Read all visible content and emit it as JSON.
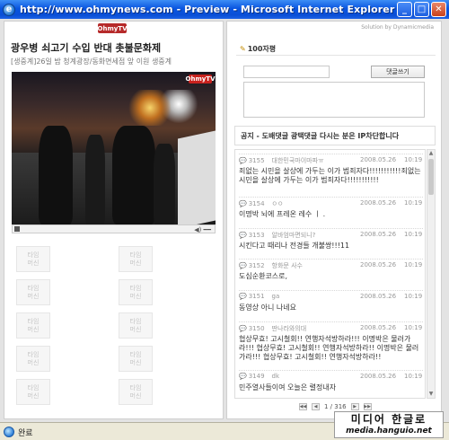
{
  "window": {
    "title": "http://www.ohmynews.com - Preview - Microsoft Internet Explorer",
    "minimize": "_",
    "maximize": "□",
    "close": "✕"
  },
  "left": {
    "tab_label": "OhmyTV",
    "headline": "광우병 쇠고기 수입 반대 촛불문화제",
    "subhead": "[생중계]26일 밤 청계광장/동화면세점 앞 이원 생중계",
    "video_badge": "OhmyTV",
    "volume": "◀) ━━",
    "tile_label_1": "타임",
    "tile_label_2": "머신",
    "tile_count": 10
  },
  "right": {
    "solution": "Solution by Dynamicmedia",
    "comment_count": "100자평",
    "post_button": "댓글쓰기",
    "notice": "공지 - 도배댓글 광택댓글 다시는 분은 IP차단합니다",
    "comments": [
      {
        "num": "3155",
        "user": "대한민국마이마파ㅠ",
        "date": "2008.05.26",
        "time": "10:19",
        "text": "죄없는 시민을 살상에 가두는 이가 범죄자다!!!!!!!!!!!죄없는 시민을 살상에 가두는 이가 범죄자다!!!!!!!!!!!"
      },
      {
        "num": "3154",
        "user": "ㅇㅇ",
        "date": "2008.05.26",
        "time": "10:19",
        "text": "이명박 뇌에 프레온 레수 ㅣ ."
      },
      {
        "num": "3153",
        "user": "알바엄마면되니?",
        "date": "2008.05.26",
        "time": "10:19",
        "text": "시킨다고 때리나 전경들 개불쌍!!!11"
      },
      {
        "num": "3152",
        "user": "항화문 사수",
        "date": "2008.05.26",
        "time": "10:19",
        "text": "도심순환코스로,"
      },
      {
        "num": "3151",
        "user": "ga",
        "date": "2008.05.26",
        "time": "10:19",
        "text": "동영상 아니 나네요"
      },
      {
        "num": "3150",
        "user": "딴나라와의대",
        "date": "2008.05.26",
        "time": "10:19",
        "text": "협상무효! 고시철회!! 연행자석방하라!!! 이명박은 물러가라!!! 협상무효! 고시철회!! 연행자석방하라!! 이명박은 물러가라!!! 협상무효! 고시철회!! 연행자석방하라!!"
      },
      {
        "num": "3149",
        "user": "dk",
        "date": "2008.05.26",
        "time": "10:19",
        "text": "민주열사들이여 오늘은 렬정내자"
      }
    ],
    "pager": "1 / 316"
  },
  "status": {
    "text": "완료"
  },
  "watermark": {
    "line1": "미디어 한글로",
    "line2": "media.hanguio.net"
  }
}
